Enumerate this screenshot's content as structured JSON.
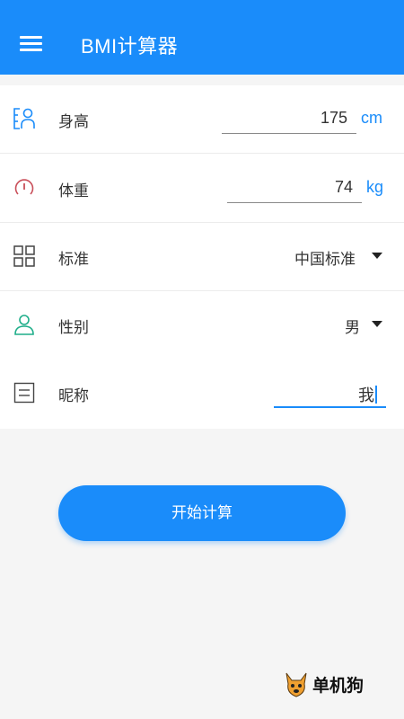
{
  "app": {
    "title": "BMI计算器"
  },
  "form": {
    "height": {
      "label": "身高",
      "value": "175",
      "unit": "cm"
    },
    "weight": {
      "label": "体重",
      "value": "74",
      "unit": "kg"
    },
    "standard": {
      "label": "标准",
      "value": "中国标准"
    },
    "gender": {
      "label": "性别",
      "value": "男"
    },
    "nickname": {
      "label": "昵称",
      "value": "我"
    }
  },
  "actions": {
    "calculate_label": "开始计算"
  },
  "watermark": {
    "text": "单机狗"
  }
}
